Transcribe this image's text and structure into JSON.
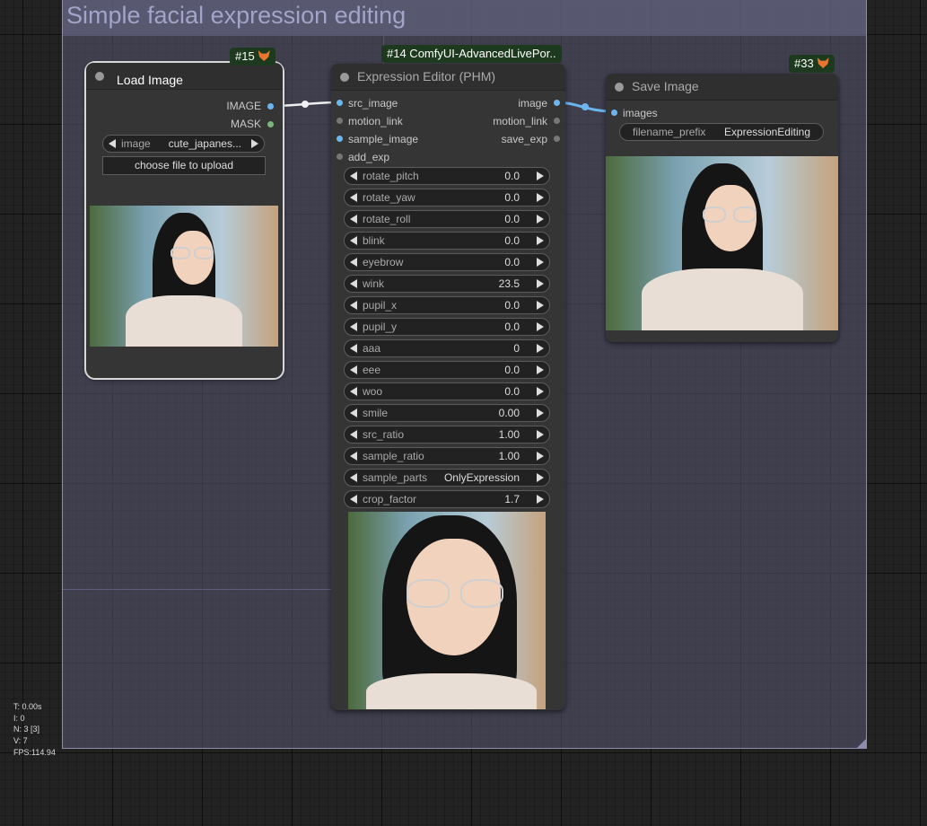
{
  "group": {
    "title": "Simple facial expression editing"
  },
  "nodes": {
    "load_image": {
      "badge": "#15",
      "title": "Load Image",
      "outputs": [
        "IMAGE",
        "MASK"
      ],
      "image_widget": {
        "label": "image",
        "value": "cute_japanes..."
      },
      "upload_button": "choose file to upload"
    },
    "expression_editor": {
      "badge": "#14 ComfyUI-AdvancedLivePor..",
      "title": "Expression Editor (PHM)",
      "inputs": [
        "src_image",
        "motion_link",
        "sample_image",
        "add_exp"
      ],
      "outputs": [
        "image",
        "motion_link",
        "save_exp"
      ],
      "widgets": [
        {
          "label": "rotate_pitch",
          "value": "0.0"
        },
        {
          "label": "rotate_yaw",
          "value": "0.0"
        },
        {
          "label": "rotate_roll",
          "value": "0.0"
        },
        {
          "label": "blink",
          "value": "0.0"
        },
        {
          "label": "eyebrow",
          "value": "0.0"
        },
        {
          "label": "wink",
          "value": "23.5"
        },
        {
          "label": "pupil_x",
          "value": "0.0"
        },
        {
          "label": "pupil_y",
          "value": "0.0"
        },
        {
          "label": "aaa",
          "value": "0"
        },
        {
          "label": "eee",
          "value": "0.0"
        },
        {
          "label": "woo",
          "value": "0.0"
        },
        {
          "label": "smile",
          "value": "0.00"
        },
        {
          "label": "src_ratio",
          "value": "1.00"
        },
        {
          "label": "sample_ratio",
          "value": "1.00"
        },
        {
          "label": "sample_parts",
          "value": "OnlyExpression"
        },
        {
          "label": "crop_factor",
          "value": "1.7"
        }
      ]
    },
    "save_image": {
      "badge": "#33",
      "title": "Save Image",
      "inputs": [
        "images"
      ],
      "filename_widget": {
        "label": "filename_prefix",
        "value": "ExpressionEditing"
      }
    }
  },
  "stats": {
    "t": "T: 0.00s",
    "i": "I: 0",
    "n": "N: 3 [3]",
    "v": "V: 7",
    "fps": "FPS:114.94"
  },
  "colors": {
    "image_slot": "#6cb6f0",
    "mask_slot": "#7bb57b",
    "badge_bg": "#1e3a1e",
    "group_title": "#a3a4c8"
  }
}
